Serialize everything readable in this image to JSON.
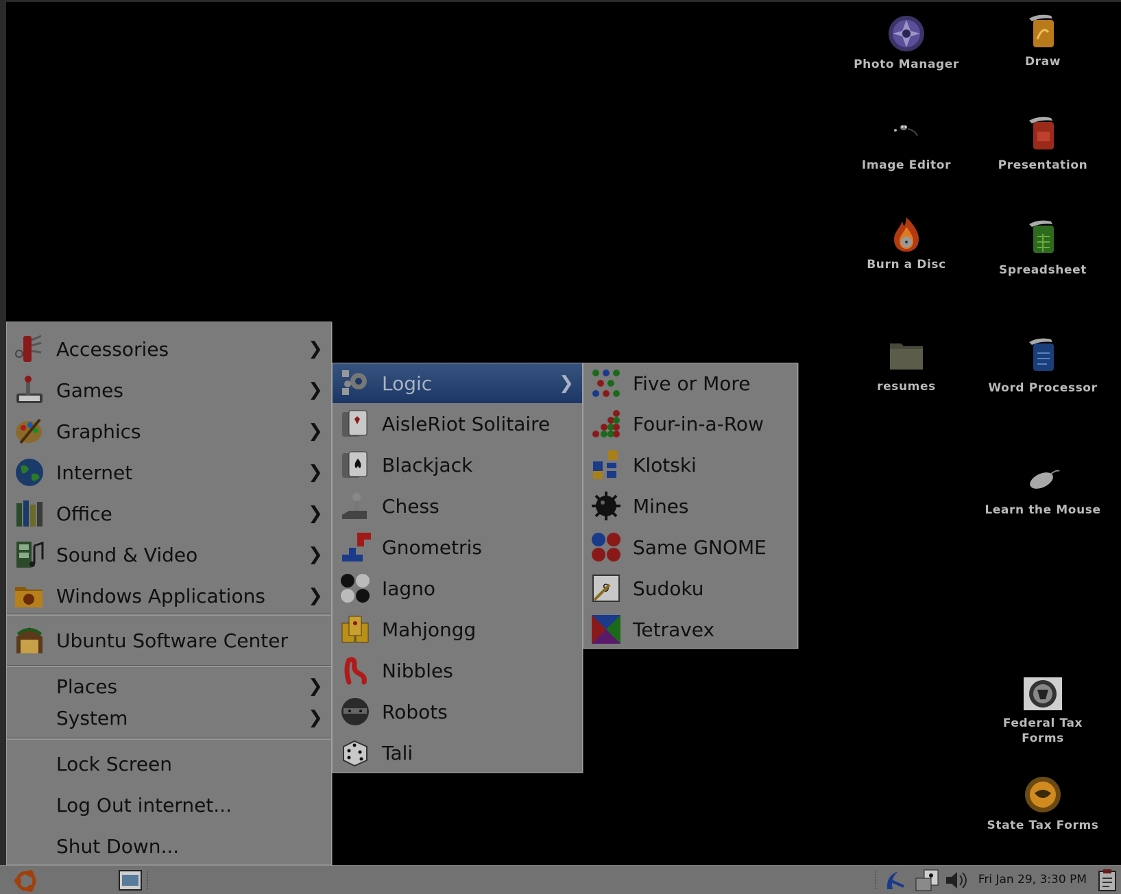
{
  "desktop_icons": [
    {
      "label": "Photo Manager",
      "icon": "photo-manager-icon"
    },
    {
      "label": "Draw",
      "icon": "draw-icon"
    },
    {
      "label": "Image Editor",
      "icon": "image-editor-icon"
    },
    {
      "label": "Presentation",
      "icon": "presentation-icon"
    },
    {
      "label": "Burn a Disc",
      "icon": "burn-disc-icon"
    },
    {
      "label": "Spreadsheet",
      "icon": "spreadsheet-icon"
    },
    {
      "label": "resumes",
      "icon": "folder-icon"
    },
    {
      "label": "Word Processor",
      "icon": "word-processor-icon"
    },
    {
      "label": "Learn the Mouse",
      "icon": "mouse-icon"
    },
    {
      "label": "Federal Tax Forms",
      "label_line1": "Federal Tax",
      "label_line2": "Forms",
      "icon": "irs-seal-icon"
    },
    {
      "label": "State Tax Forms",
      "icon": "state-seal-icon"
    }
  ],
  "main_menu": {
    "categories": [
      {
        "label": "Accessories",
        "icon": "accessories-icon"
      },
      {
        "label": "Games",
        "icon": "games-icon"
      },
      {
        "label": "Graphics",
        "icon": "graphics-icon"
      },
      {
        "label": "Internet",
        "icon": "internet-icon"
      },
      {
        "label": "Office",
        "icon": "office-icon"
      },
      {
        "label": "Sound & Video",
        "icon": "sound-video-icon"
      },
      {
        "label": "Windows Applications",
        "icon": "windows-apps-icon"
      }
    ],
    "software_center": "Ubuntu Software Center",
    "places": "Places",
    "system": "System",
    "lock_screen": "Lock Screen",
    "log_out": "Log Out internet...",
    "shut_down": "Shut Down..."
  },
  "games_menu": {
    "items": [
      {
        "label": "Logic",
        "icon": "logic-icon",
        "submenu": true,
        "active": true
      },
      {
        "label": "AisleRiot Solitaire",
        "icon": "solitaire-icon"
      },
      {
        "label": "Blackjack",
        "icon": "blackjack-icon"
      },
      {
        "label": "Chess",
        "icon": "chess-icon"
      },
      {
        "label": "Gnometris",
        "icon": "gnometris-icon"
      },
      {
        "label": "Iagno",
        "icon": "iagno-icon"
      },
      {
        "label": "Mahjongg",
        "icon": "mahjongg-icon"
      },
      {
        "label": "Nibbles",
        "icon": "nibbles-icon"
      },
      {
        "label": "Robots",
        "icon": "robots-icon"
      },
      {
        "label": "Tali",
        "icon": "dice-icon"
      }
    ]
  },
  "logic_menu": {
    "items": [
      {
        "label": "Five or More",
        "icon": "five-or-more-icon"
      },
      {
        "label": "Four-in-a-Row",
        "icon": "four-in-a-row-icon"
      },
      {
        "label": "Klotski",
        "icon": "klotski-icon"
      },
      {
        "label": "Mines",
        "icon": "mines-icon"
      },
      {
        "label": "Same GNOME",
        "icon": "same-gnome-icon"
      },
      {
        "label": "Sudoku",
        "icon": "sudoku-icon"
      },
      {
        "label": "Tetravex",
        "icon": "tetravex-icon"
      }
    ]
  },
  "taskbar": {
    "clock": "Fri Jan 29,  3:30 PM"
  },
  "colors": {
    "menu_bg": "#7b7b7b",
    "highlight": "#1c3766",
    "desktop_bg": "#000000",
    "taskbar_bg": "#727272"
  }
}
